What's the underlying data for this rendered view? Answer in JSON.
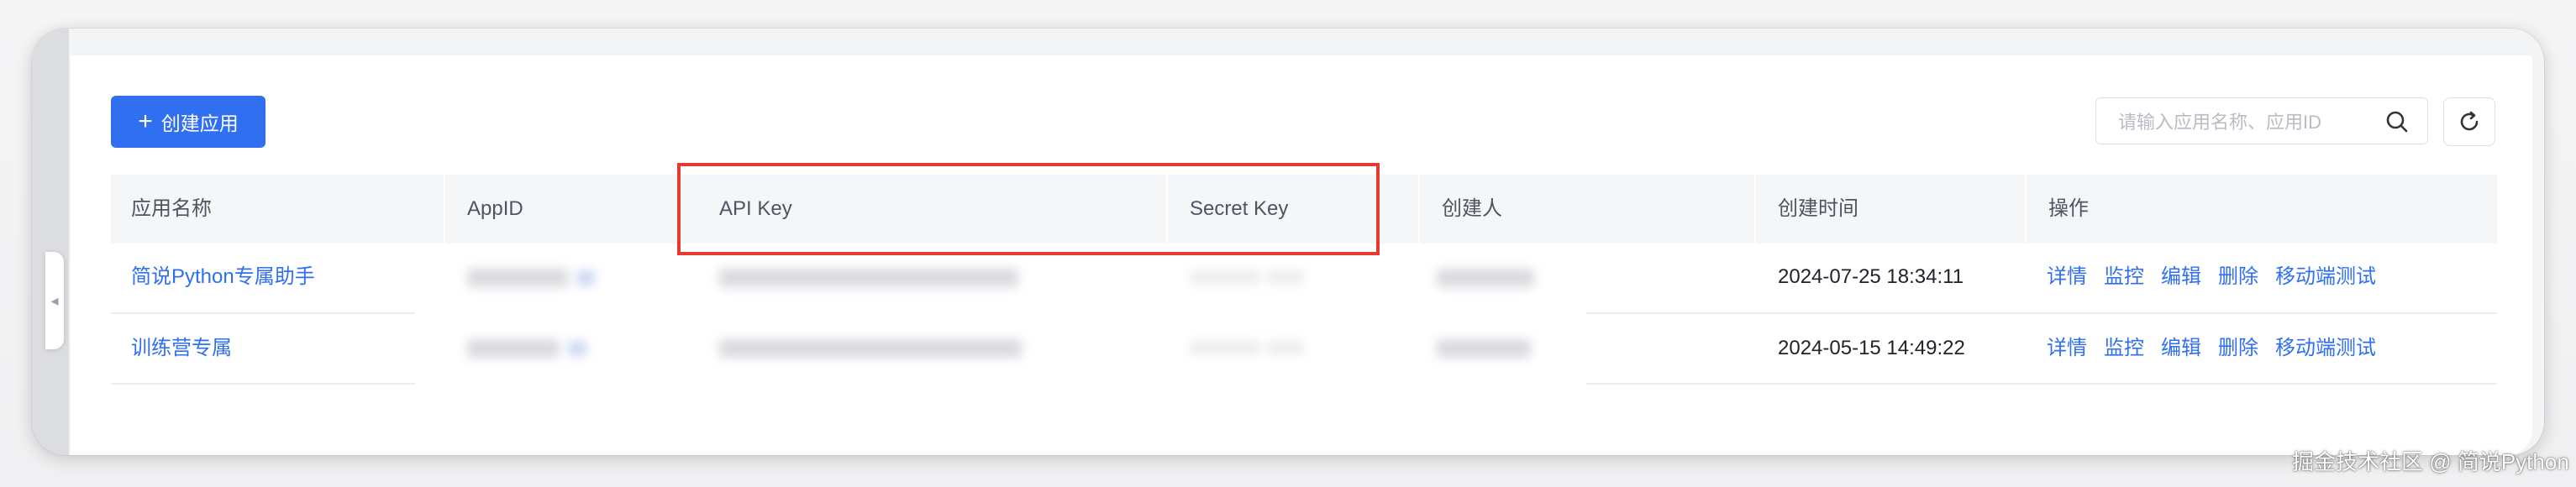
{
  "toolbar": {
    "create_button_label": "创建应用",
    "search_placeholder": "请输入应用名称、应用ID"
  },
  "table": {
    "columns": [
      "应用名称",
      "AppID",
      "API Key",
      "Secret Key",
      "创建人",
      "创建时间",
      "操作"
    ],
    "rows": [
      {
        "name": "简说Python专属助手",
        "created_at": "2024-07-25 18:34:11"
      },
      {
        "name": "训练营专属",
        "created_at": "2024-05-15 14:49:22"
      }
    ],
    "actions": [
      "详情",
      "监控",
      "编辑",
      "删除",
      "移动端测试"
    ]
  },
  "watermark": "掘金技术社区 @ 简说Python",
  "colors": {
    "accent": "#2f6ff0",
    "highlight": "#e43a2f"
  },
  "icons": [
    "plus-icon",
    "search-icon",
    "refresh-icon",
    "chevron-left-icon"
  ]
}
